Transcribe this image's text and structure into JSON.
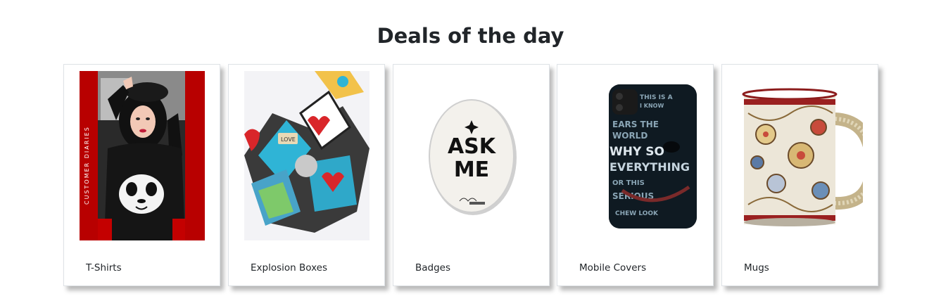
{
  "section": {
    "title": "Deals of the day"
  },
  "products": [
    {
      "label": "T-Shirts",
      "image": "tshirt-photo",
      "image_text": "CUSTOMER DIARIES"
    },
    {
      "label": "Explosion Boxes",
      "image": "explosion-box-photo",
      "image_text": "LOVE"
    },
    {
      "label": "Badges",
      "image": "badge-photo",
      "image_text": "ASK ME"
    },
    {
      "label": "Mobile Covers",
      "image": "mobile-cover-photo",
      "image_text": "WHY SO SERIOUS"
    },
    {
      "label": "Mugs",
      "image": "mug-photo"
    }
  ],
  "colors": {
    "tshirt_red": "#b80000",
    "text": "#212529",
    "card_border": "#dee2e6"
  }
}
